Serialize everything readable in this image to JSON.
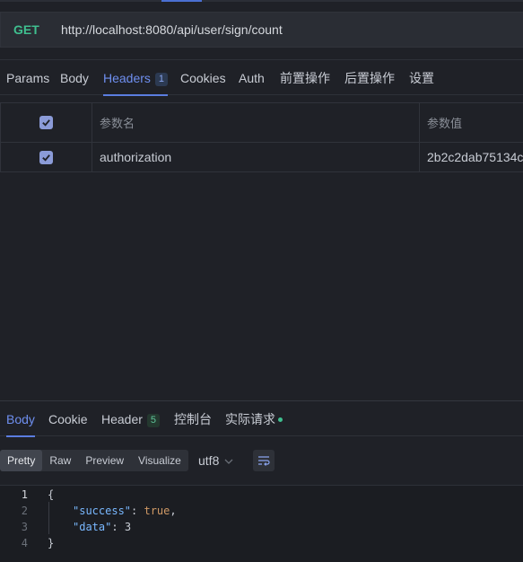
{
  "request": {
    "method": "GET",
    "url": "http://localhost:8080/api/user/sign/count"
  },
  "request_tabs": [
    {
      "label": "Params"
    },
    {
      "label": "Body"
    },
    {
      "label": "Headers",
      "badge": "1",
      "active": true
    },
    {
      "label": "Cookies"
    },
    {
      "label": "Auth"
    },
    {
      "label": "前置操作"
    },
    {
      "label": "后置操作"
    },
    {
      "label": "设置"
    }
  ],
  "headers_table": {
    "columns": {
      "name": "参数名",
      "value": "参数值"
    },
    "rows": [
      {
        "checked": true,
        "name": "authorization",
        "value": "2b2c2dab75134c"
      }
    ]
  },
  "response_tabs": [
    {
      "label": "Body",
      "active": true
    },
    {
      "label": "Cookie"
    },
    {
      "label": "Header",
      "badge": "5"
    },
    {
      "label": "控制台"
    },
    {
      "label": "实际请求",
      "dot": true
    }
  ],
  "view_modes": [
    "Pretty",
    "Raw",
    "Preview",
    "Visualize"
  ],
  "active_view": "Pretty",
  "encoding": "utf8",
  "response_body": {
    "line_numbers": [
      "1",
      "2",
      "3",
      "4"
    ],
    "open_brace": "{",
    "close_brace": "}",
    "fields": [
      {
        "key": "\"success\"",
        "value": "true",
        "suffix": ","
      },
      {
        "key": "\"data\"",
        "value": "3",
        "suffix": ""
      }
    ]
  },
  "colors": {
    "accent": "#6f8ff0",
    "method_get": "#3fbf8f",
    "json_key": "#79b8ff",
    "json_bool": "#d19a66",
    "background": "#1f2127"
  },
  "icons": {
    "checkbox": "check-icon",
    "encoding_dropdown": "chevron-down-icon",
    "wrap": "word-wrap-icon"
  }
}
